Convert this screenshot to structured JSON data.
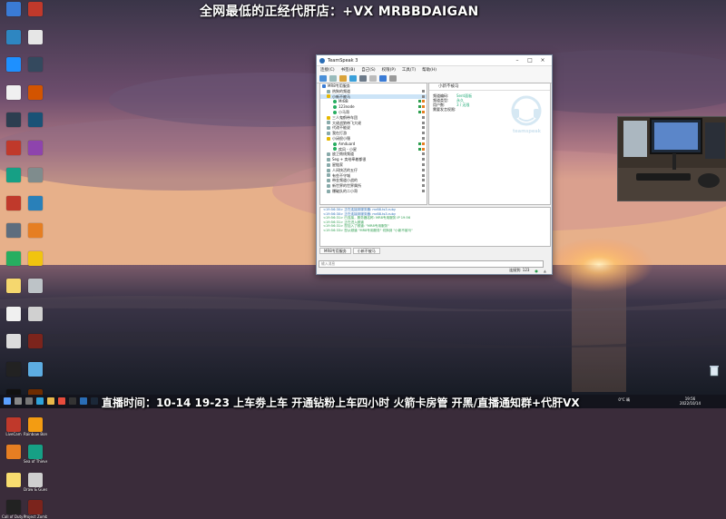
{
  "banners": {
    "top": "全网最低的正经代肝店：+VX MRBBDAIGAN",
    "bottom": "直播时间：10-14 19-23 上车劵上车 开通钻粉上车四小时 火箭卡房管 开黑/直播通知群+代肝VX"
  },
  "desktop_icons": [
    {
      "label": "",
      "color": "#3a7bd5"
    },
    {
      "label": "",
      "color": "#c0392b"
    },
    {
      "label": "",
      "color": "#2e86c1"
    },
    {
      "label": "",
      "color": "#e6e6e6"
    },
    {
      "label": "",
      "color": "#1e90ff"
    },
    {
      "label": "",
      "color": "#34495e"
    },
    {
      "label": "",
      "color": "#f0f0f0"
    },
    {
      "label": "",
      "color": "#d35400"
    },
    {
      "label": "",
      "color": "#2c3e50"
    },
    {
      "label": "",
      "color": "#1a5276"
    },
    {
      "label": "",
      "color": "#c0392b"
    },
    {
      "label": "",
      "color": "#8e44ad"
    },
    {
      "label": "",
      "color": "#16a085"
    },
    {
      "label": "",
      "color": "#7f8c8d"
    },
    {
      "label": "",
      "color": "#c0392b"
    },
    {
      "label": "",
      "color": "#2980b9"
    },
    {
      "label": "",
      "color": "#5d6d7e"
    },
    {
      "label": "",
      "color": "#e67e22"
    },
    {
      "label": "",
      "color": "#27ae60"
    },
    {
      "label": "",
      "color": "#f1c40f"
    },
    {
      "label": "",
      "color": "#f5d76e"
    },
    {
      "label": "",
      "color": "#bdc3c7"
    },
    {
      "label": "",
      "color": "#f0f0f0"
    },
    {
      "label": "",
      "color": "#d0d0d0"
    },
    {
      "label": "",
      "color": "#dcdcdc"
    },
    {
      "label": "",
      "color": "#7b241c"
    },
    {
      "label": "",
      "color": "#222222"
    },
    {
      "label": "",
      "color": "#5dade2"
    },
    {
      "label": "",
      "color": "#111111"
    },
    {
      "label": "",
      "color": "#6e2c00"
    },
    {
      "label": "LiveCam",
      "color": "#c0392b"
    },
    {
      "label": "Rainbow Borders",
      "color": "#f39c12"
    },
    {
      "label": "",
      "color": "#e67e22"
    },
    {
      "label": "Sea of Thieves",
      "color": "#16a085"
    },
    {
      "label": "",
      "color": "#f7dc6f"
    },
    {
      "label": "Draw & Guess",
      "color": "#cfcfcf"
    },
    {
      "label": "Call of Duty Modern...",
      "color": "#222222"
    },
    {
      "label": "Project Zomboid",
      "color": "#7b241c"
    }
  ],
  "teamspeak": {
    "title": "TeamSpeak 3",
    "menu": [
      "连接(C)",
      "书签(B)",
      "自己(S)",
      "权限(P)",
      "工具(T)",
      "帮助(H)"
    ],
    "channels": [
      {
        "name": "MR8专用服务",
        "icon": "server",
        "color": "#3a7bd5",
        "selected": false
      },
      {
        "name": "热狗的频道",
        "icon": "channel",
        "color": "#8aa",
        "selected": false
      },
      {
        "name": "小新不被马",
        "icon": "channel",
        "color": "#e6b800",
        "selected": true
      },
      {
        "name": "MrBB",
        "icon": "user",
        "color": "#27ae60",
        "selected": false
      },
      {
        "name": "123node",
        "icon": "user",
        "color": "#27ae60",
        "selected": false
      },
      {
        "name": "小马哥",
        "icon": "user",
        "color": "#27ae60",
        "selected": false
      },
      {
        "name": "三人鬼鹤带车团",
        "icon": "channel",
        "color": "#e6b800",
        "selected": false
      },
      {
        "name": "大佬战狼带飞大佬",
        "icon": "channel",
        "color": "#8aa",
        "selected": false
      },
      {
        "name": "代改不能说",
        "icon": "channel",
        "color": "#8aa",
        "selected": false
      },
      {
        "name": "我在打游",
        "icon": "channel",
        "color": "#8aa",
        "selected": false
      },
      {
        "name": "小闭很小锤",
        "icon": "channel",
        "color": "#e6b800",
        "selected": false
      },
      {
        "name": "Amduard",
        "icon": "user",
        "color": "#27ae60",
        "selected": false
      },
      {
        "name": "疾风 - 小星",
        "icon": "user",
        "color": "#27ae60",
        "selected": false
      },
      {
        "name": "放卫南线频道",
        "icon": "channel",
        "color": "#8aa",
        "selected": false
      },
      {
        "name": "Seg + 卖给牵着都很",
        "icon": "channel",
        "color": "#8aa",
        "selected": false
      },
      {
        "name": "星链家",
        "icon": "channel",
        "color": "#8aa",
        "selected": false
      },
      {
        "name": "人间快活的五仔",
        "icon": "channel",
        "color": "#8aa",
        "selected": false
      },
      {
        "name": "有些不守城",
        "icon": "channel",
        "color": "#8aa",
        "selected": false
      },
      {
        "name": "带金频道小战的",
        "icon": "channel",
        "color": "#8aa",
        "selected": false
      },
      {
        "name": "新世界的世界属所",
        "icon": "channel",
        "color": "#8aa",
        "selected": false
      },
      {
        "name": "爆破队的二小哥",
        "icon": "channel",
        "color": "#8aa",
        "selected": false
      }
    ],
    "info": {
      "header": "小新不被马",
      "rows": [
        {
          "k": "频道编码:",
          "v": "Sent面板"
        },
        {
          "k": "频道类型:",
          "v": "永久"
        },
        {
          "k": "用户数:",
          "v": "3 / 无限"
        },
        {
          "k": "需要发言权限:",
          "v": ""
        }
      ],
      "logo_text": "teamspeak"
    },
    "log": [
      {
        "text": "<19:56:30> 正在连接到服务器: mr88.ts3.ruby",
        "color": "#2a6db5"
      },
      {
        "text": "<19:56:30> 正在连接到服务器: mr88.ts3.ruby",
        "color": "#2a6db5"
      },
      {
        "text": "<19:56:31> 已连接，服务器名称: MR8专用服务 IP 19:56",
        "color": "#2e9e4f"
      },
      {
        "text": "<19:56:31> 正在进入频道",
        "color": "#2e9e4f"
      },
      {
        "text": "<19:56:31> 您加入了频道: \"MR8专用服务\"",
        "color": "#2e9e4f"
      },
      {
        "text": "<19:56:33> 您从频道 \"MR8专用服务\" 切换到 \"小新不被马\"",
        "color": "#2e9e4f"
      }
    ],
    "tabs": [
      "MR8专用服务",
      "小新不被马"
    ],
    "input_placeholder": "输入消息",
    "status": [
      "连接到: 123",
      "●",
      "▲"
    ]
  },
  "taskbar": {
    "weather": "0°C 晴",
    "time": "19:56",
    "date": "2022/10/14"
  },
  "colors": {
    "sky_top": "#3b3447",
    "sky_mid": "#8a6a7e",
    "sea": "#1f2a38",
    "sun": "#ffcf7a"
  }
}
